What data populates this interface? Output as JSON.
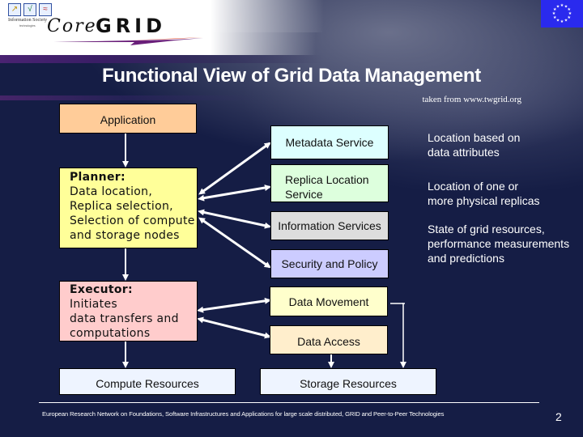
{
  "header": {
    "info_society_logo_text": "Information Society",
    "info_society_logo_subtext": "technologies",
    "coregrid_logo_core": "Core",
    "coregrid_logo_grid": "GRID",
    "eu_flag_icon": "eu-flag-icon"
  },
  "slide": {
    "title": "Functional View of Grid Data Management",
    "source_note": "taken from www.twgrid.org",
    "page_number": "2"
  },
  "diagram": {
    "application": "Application",
    "planner": {
      "heading": "Planner:",
      "lines": [
        "Data location,",
        "Replica selection,",
        "Selection of compute",
        "and storage nodes"
      ]
    },
    "executor": {
      "heading": "Executor:",
      "lines": [
        "Initiates",
        "data transfers and",
        "computations"
      ]
    },
    "compute_resources": "Compute Resources",
    "storage_resources": "Storage Resources",
    "services": [
      {
        "label_lines": [
          "Metadata Service"
        ],
        "color": "#ddffff"
      },
      {
        "label_lines": [
          "Replica Location",
          "Service"
        ],
        "color": "#ddffdd"
      },
      {
        "label_lines": [
          "Information Services"
        ],
        "color": "#dddddd"
      },
      {
        "label_lines": [
          "Security and Policy"
        ],
        "color": "#ccccff"
      }
    ],
    "data_services": [
      {
        "label": "Data Movement",
        "color": "#ffffcc"
      },
      {
        "label": "Data Access",
        "color": "#ffeecc"
      }
    ],
    "descriptions": [
      {
        "lines": [
          "Location based on",
          "data attributes"
        ]
      },
      {
        "lines": [
          "Location of one or",
          "more physical replicas"
        ]
      },
      {
        "lines": [
          "State of grid resources,",
          "performance measurements",
          "and predictions"
        ]
      }
    ],
    "colors": {
      "application": "#ffcc99",
      "planner": "#ffff99",
      "executor": "#ffcccc",
      "resources": "#eef4ff",
      "background": "#151d45"
    }
  },
  "footer": {
    "text": "European Research Network on Foundations, Software Infrastructures and Applications for large scale distributed, GRID and Peer-to-Peer Technologies"
  }
}
